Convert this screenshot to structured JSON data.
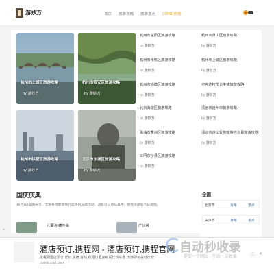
{
  "header": {
    "brand": "游妙方",
    "nav": [
      "首页",
      "旅游攻略",
      "旅游景点",
      "CMND攻略"
    ],
    "accent": "#f0ad3c"
  },
  "cards": [
    {
      "title": "杭州市上城区旅游攻略",
      "author": "by 游妙方",
      "scene": "bridge"
    },
    {
      "title": "杭州市临安区旅游攻略",
      "author": "by 游妙方",
      "scene": "river"
    },
    {
      "title": "杭州市拱墅区旅游攻略",
      "author": "by 游妙方",
      "scene": "city"
    },
    {
      "title": "北京市东城区旅游攻略",
      "author": "by 游妙方",
      "scene": "statue"
    }
  ],
  "list_col1": [
    {
      "title": "杭州市富阳区旅游攻略",
      "by": "by",
      "name": "游妙方"
    },
    {
      "title": "杭州市余杭区旅游攻略",
      "by": "by",
      "name": "游妙方"
    },
    {
      "title": "杭州市钱塘区旅游攻略",
      "by": "by",
      "name": "游妙方"
    },
    {
      "title": "北京海淀区旅游攻略",
      "by": "by",
      "name": "游妙方"
    },
    {
      "title": "珠海市香洲区旅游攻略",
      "by": "by",
      "name": "游妙方"
    },
    {
      "title": "三明市沙县区旅游攻略",
      "by": "by",
      "name": "游妙方"
    }
  ],
  "list_col2": [
    {
      "title": "杭州市萧山区旅游攻略",
      "by": "by",
      "name": "游妙方"
    },
    {
      "title": "杭州市上城区旅游攻略",
      "by": "by",
      "name": "游妙方"
    },
    {
      "title": "可克达拉市长丰镇旅游攻略",
      "by": "by",
      "name": "游妙方"
    },
    {
      "title": "清远市连州市旅游攻略",
      "by": "by",
      "name": "游妙方"
    },
    {
      "title": "清远市连山壮族瑶族自治县旅游攻略",
      "by": "by",
      "name": "游妙方"
    }
  ],
  "section": {
    "title": "国庆庆典",
    "desc": "10月1日是国庆节，全国各地都会举行盛大的庆典活动，游客可以参与其中，感受浓厚的节日氛围。"
  },
  "side": {
    "title": "全国",
    "rows": [
      {
        "city": "北京市",
        "a": "攻略",
        "b": "景点"
      },
      {
        "city": "天津市",
        "a": "攻略",
        "b": "景点"
      }
    ]
  },
  "row_items": [
    {
      "text": "九寨沟-藏牛海"
    },
    {
      "text": "广州塔"
    }
  ],
  "ad": {
    "headline": "酒店预订,携程网 - 酒店预订,携程官网",
    "sub": "携程网酒店预订,低价,民宿,客栈,携程订酒店就是比较实惠,出游即可在线比较",
    "url": "hotels.ctrip.com",
    "watermark": "自动秒收录",
    "watermark_sub": "提交一个网站 · 手动一次收录"
  }
}
